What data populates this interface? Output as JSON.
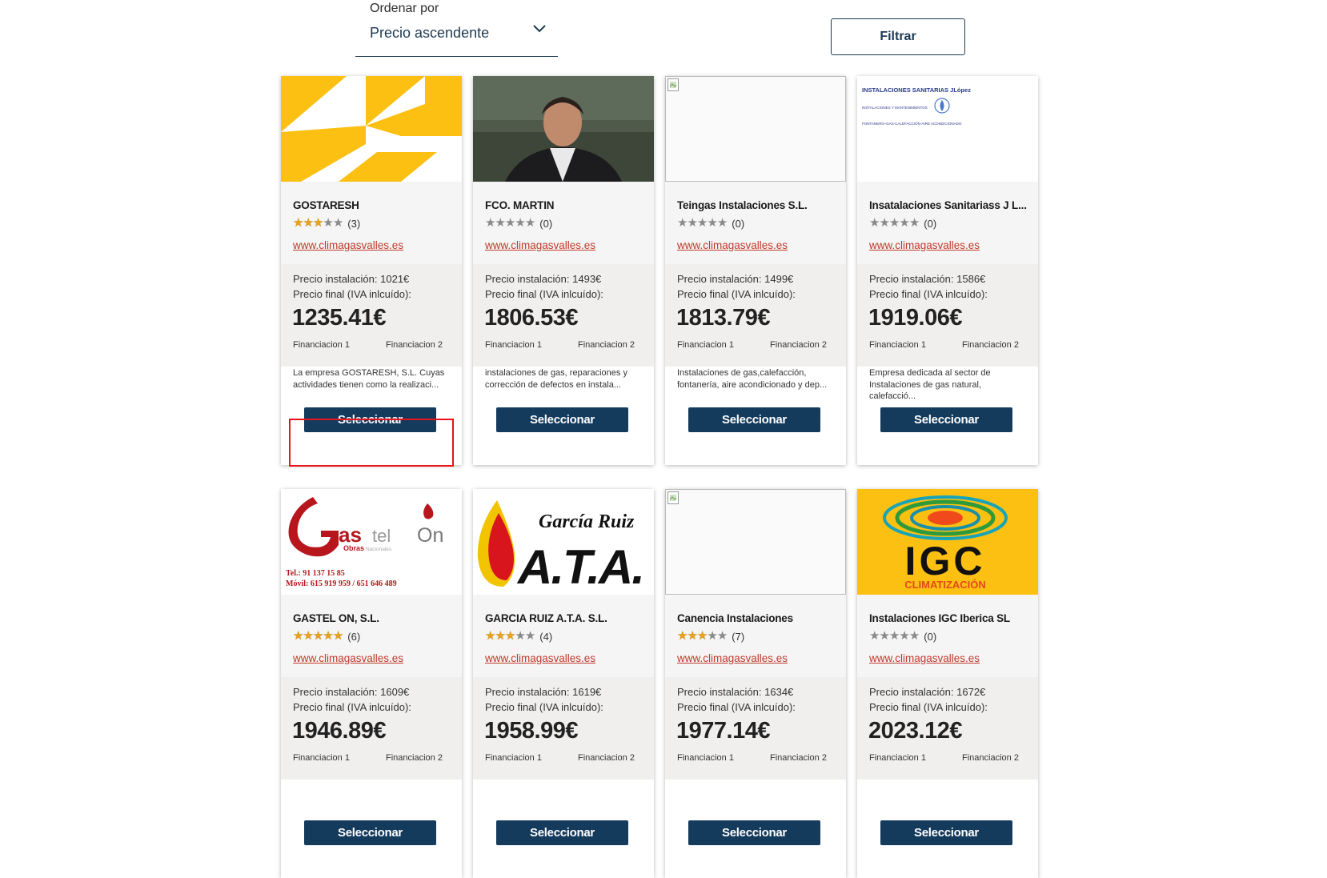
{
  "sort": {
    "label": "Ordenar por",
    "value": "Precio ascendente"
  },
  "filter": {
    "label": "Filtrar"
  },
  "labels": {
    "price_install": "Precio instalación:",
    "price_final": "Precio final (IVA inlcuído):",
    "fin1": "Financiacion 1",
    "fin2": "Financiacion 2",
    "select": "Seleccionar"
  },
  "cards": [
    {
      "name": "GOSTARESH",
      "stars": 3,
      "count": "(3)",
      "link": "www.climagasvalles.es",
      "install": "1021€",
      "final": "1235.41€",
      "desc": "La empresa GOSTARESH, S.L. Cuyas actividades tienen como la realizaci...",
      "image": "gostaresh-logo"
    },
    {
      "name": "FCO. MARTIN",
      "stars": 0,
      "count": "(0)",
      "link": "www.climagasvalles.es",
      "install": "1493€",
      "final": "1806.53€",
      "desc": "instalaciones de gas, reparaciones y corrección de defectos en instala...",
      "image": "person-photo"
    },
    {
      "name": "Teingas Instalaciones S.L.",
      "stars": 0,
      "count": "(0)",
      "link": "www.climagasvalles.es",
      "install": "1499€",
      "final": "1813.79€",
      "desc": "Instalaciones de gas,calefacción, fontanería, aire acondicionado y dep...",
      "image": "broken-image"
    },
    {
      "name": "Insatalaciones Sanitariass J L...",
      "stars": 0,
      "count": "(0)",
      "link": "www.climagasvalles.es",
      "install": "1586€",
      "final": "1919.06€",
      "desc": "Empresa dedicada al sector de Instalaciones de gas natural, calefacció...",
      "image": "sanitarias-logo"
    },
    {
      "name": "GASTEL ON, S.L.",
      "stars": 5,
      "count": "(6)",
      "link": "www.climagasvalles.es",
      "install": "1609€",
      "final": "1946.89€",
      "desc": "",
      "image": "gastel-logo"
    },
    {
      "name": "GARCIA RUIZ A.T.A. S.L.",
      "stars": 3,
      "count": "(4)",
      "link": "www.climagasvalles.es",
      "install": "1619€",
      "final": "1958.99€",
      "desc": "",
      "image": "garcia-ruiz-logo"
    },
    {
      "name": "Canencia Instalaciones",
      "stars": 3,
      "count": "(7)",
      "link": "www.climagasvalles.es",
      "install": "1634€",
      "final": "1977.14€",
      "desc": "",
      "image": "broken-image"
    },
    {
      "name": "Instalaciones IGC Iberica SL",
      "stars": 0,
      "count": "(0)",
      "link": "www.climagasvalles.es",
      "install": "1672€",
      "final": "2023.12€",
      "desc": "",
      "image": "igc-logo"
    }
  ],
  "logos": {
    "sanitarias": {
      "line1": "INSTALACIONES SANITARIAS JLópez",
      "line2": "INSTALACIONES Y MANTENIMIENTOS",
      "line3": "FONTANERÍA-GAS-CALEFACCIÓN-AIRE ACONDICIONADO"
    },
    "gastel": {
      "brand1": "as",
      "brand2": "tel",
      "brand3": "On",
      "sub1": "Obras",
      "sub2": "Nacionales",
      "tel": "Tel.: 91 137 15 85",
      "movil": "Móvil: 615 919 959 / 651 646 489"
    },
    "garcia": {
      "script": "García Ruiz",
      "letters": "A.T.A."
    },
    "igc": {
      "letters": "IGC",
      "sub": "CLIMATIZACIÓN"
    }
  },
  "colors": {
    "accent": "#143a5c",
    "link": "#c0392b",
    "star": "#e8a21b",
    "highlight": "#e8131b",
    "yellow": "#fcc012"
  }
}
